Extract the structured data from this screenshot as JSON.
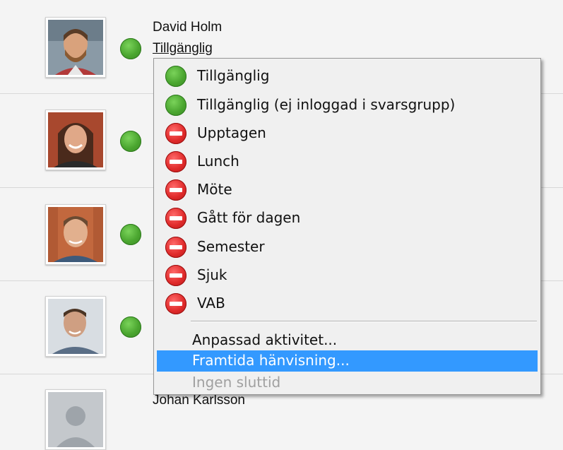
{
  "contacts": [
    {
      "name": "David Holm",
      "status": "Tillgänglig"
    },
    {
      "name": "",
      "status": ""
    },
    {
      "name": "",
      "status": ""
    },
    {
      "name": "",
      "status": ""
    },
    {
      "name": "Johan Karlsson",
      "status": ""
    }
  ],
  "status_menu": {
    "items": [
      {
        "label": "Tillgänglig",
        "icon": "available-icon"
      },
      {
        "label": "Tillgänglig (ej inloggad i svarsgrupp)",
        "icon": "available-icon"
      },
      {
        "label": "Upptagen",
        "icon": "busy-icon"
      },
      {
        "label": "Lunch",
        "icon": "busy-icon"
      },
      {
        "label": "Möte",
        "icon": "busy-icon"
      },
      {
        "label": "Gått för dagen",
        "icon": "busy-icon"
      },
      {
        "label": "Semester",
        "icon": "busy-icon"
      },
      {
        "label": "Sjuk",
        "icon": "busy-icon"
      },
      {
        "label": "VAB",
        "icon": "busy-icon"
      }
    ],
    "custom_activity": "Anpassad aktivitet...",
    "future_referral": "Framtida hänvisning...",
    "no_end_time": "Ingen sluttid"
  },
  "colors": {
    "available": "#4aa52f",
    "busy": "#e02b2b",
    "highlight": "#3399ff"
  }
}
